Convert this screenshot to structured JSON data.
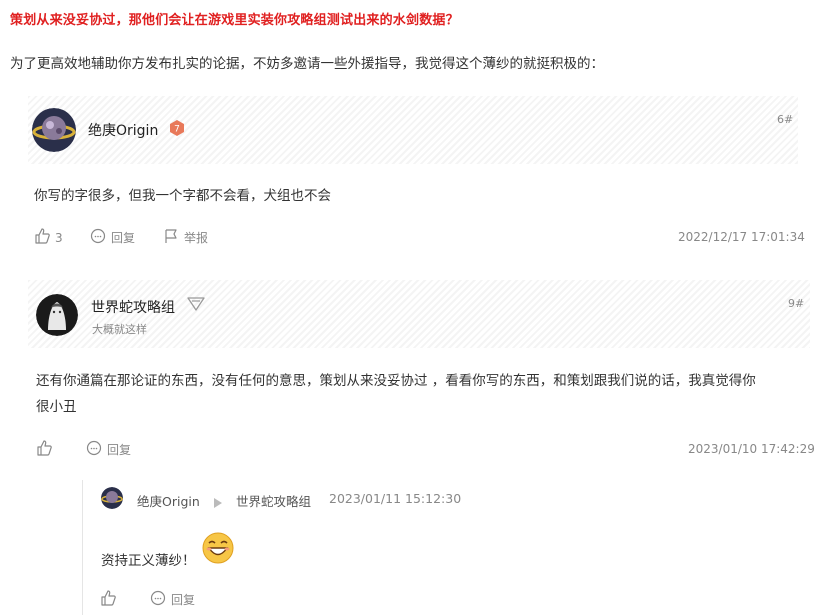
{
  "headline": "策划从来没妥协过，那他们会让在游戏里实装你攻略组测试出来的水剑数据？",
  "intro": "为了更高效地辅助你方发布扎实的论据，不妨多邀请一些外援指导，我觉得这个薄纱的就挺积极的：",
  "post1": {
    "username": "绝庚Origin",
    "level": "7",
    "floor": "6#",
    "body": "你写的字很多，但我一个字都不会看，犬组也不会",
    "like_count": "3",
    "reply_label": "回复",
    "report_label": "举报",
    "timestamp": "2022/12/17 17:01:34"
  },
  "post2": {
    "username": "世界蛇攻略组",
    "subtitle": "大概就这样",
    "floor": "9#",
    "body_line1": "还有你通篇在那论证的东西，没有任何的意思，策划从来没妥协过 ，看看你写的东西，和策划跟我们说的话，我真觉得你",
    "body_line2": "很小丑",
    "reply_label": "回复",
    "timestamp": "2023/01/10 17:42:29"
  },
  "reply": {
    "from_user": "绝庚Origin",
    "to_user": "世界蛇攻略组",
    "timestamp": "2023/01/11 15:12:30",
    "body": "资持正义薄纱！",
    "reply_label": "回复"
  },
  "colors": {
    "headline": "#e02020",
    "level_badge": "#e8795a"
  }
}
